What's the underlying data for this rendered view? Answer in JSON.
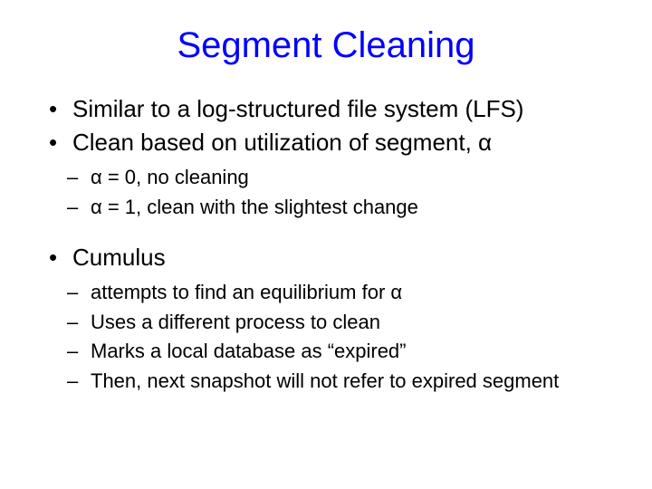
{
  "title": "Segment Cleaning",
  "bullets": {
    "b1": "Similar to a log-structured file system (LFS)",
    "b2": "Clean based on utilization of segment, α",
    "b2_sub": {
      "s1": "α = 0, no cleaning",
      "s2": "α = 1, clean with the slightest change"
    },
    "b3": "Cumulus",
    "b3_sub": {
      "s1": "attempts to find an equilibrium for α",
      "s2": "Uses a different process to clean",
      "s3": "Marks a local database as “expired”",
      "s4": "Then, next snapshot will not refer to expired segment"
    }
  }
}
